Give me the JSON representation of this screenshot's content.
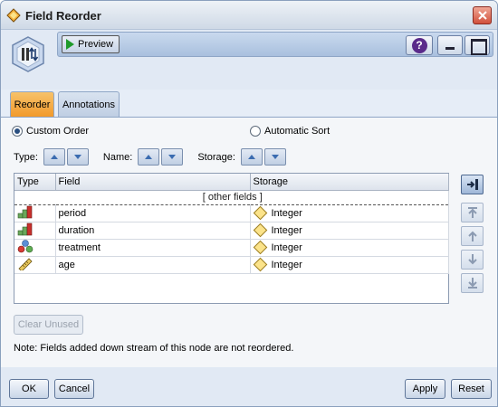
{
  "window": {
    "title": "Field Reorder",
    "icons": {
      "app": "field-reorder-diamond-icon",
      "close": "close-icon"
    }
  },
  "toolbar": {
    "preview_label": "Preview",
    "help_icon": "help-icon",
    "minimize_icon": "minimize-icon",
    "maximize_icon": "maximize-icon"
  },
  "tabs": [
    {
      "label": "Reorder",
      "active": true
    },
    {
      "label": "Annotations",
      "active": false
    }
  ],
  "order_mode": {
    "custom_label": "Custom Order",
    "auto_label": "Automatic Sort",
    "selected": "custom"
  },
  "sort_controls": {
    "type_label": "Type:",
    "name_label": "Name:",
    "storage_label": "Storage:"
  },
  "table": {
    "columns": [
      "Type",
      "Field",
      "Storage"
    ],
    "other_fields_label": "[ other fields ]",
    "rows": [
      {
        "type_icon": "flag-ordinal-icon",
        "field": "period",
        "storage_icon": "integer-diamond-icon",
        "storage": "Integer"
      },
      {
        "type_icon": "flag-ordinal-icon",
        "field": "duration",
        "storage_icon": "integer-diamond-icon",
        "storage": "Integer"
      },
      {
        "type_icon": "nominal-set-icon",
        "field": "treatment",
        "storage_icon": "integer-diamond-icon",
        "storage": "Integer"
      },
      {
        "type_icon": "continuous-ruler-icon",
        "field": "age",
        "storage_icon": "integer-diamond-icon",
        "storage": "Integer"
      }
    ]
  },
  "side_buttons": [
    "pick-fields-icon",
    "move-to-top-icon",
    "move-up-icon",
    "move-down-icon",
    "move-to-bottom-icon"
  ],
  "clear_unused_label": "Clear Unused",
  "note": "Note: Fields added down stream of this node are not reordered.",
  "footer": {
    "ok_label": "OK",
    "cancel_label": "Cancel",
    "apply_label": "Apply",
    "reset_label": "Reset"
  },
  "colors": {
    "active_tab": "#f29a2b",
    "title_close": "#d1503c",
    "accent_blue": "#3b6cb0"
  }
}
